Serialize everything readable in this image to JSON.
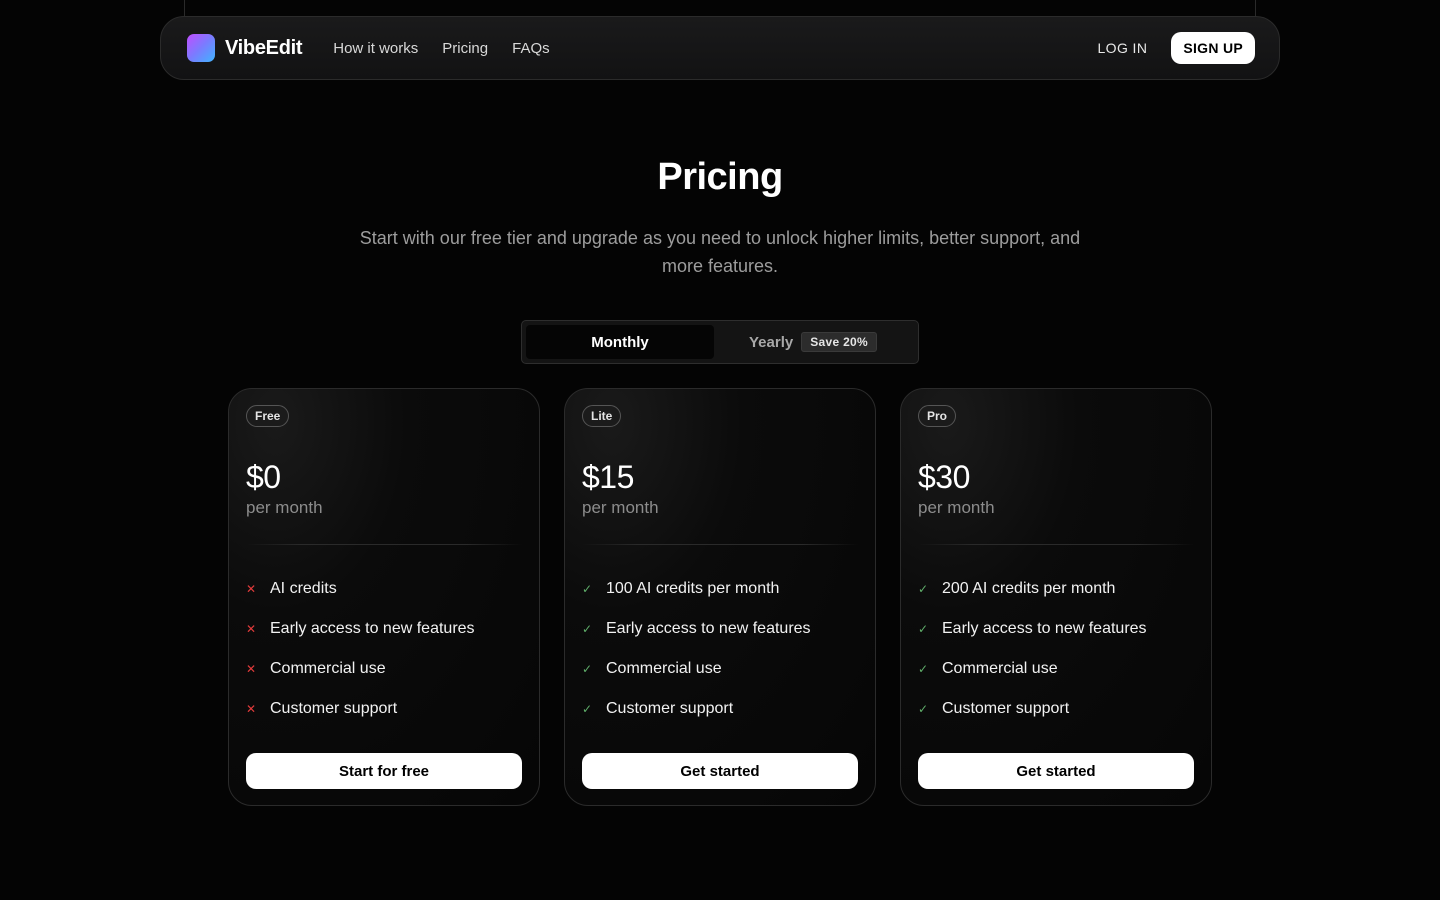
{
  "nav": {
    "brand": "VibeEdit",
    "links": [
      "How it works",
      "Pricing",
      "FAQs"
    ],
    "login": "LOG IN",
    "signup": "SIGN UP"
  },
  "hero": {
    "title": "Pricing",
    "subtitle": "Start with our free tier and upgrade as you need to unlock higher limits, better support, and more features."
  },
  "billing_toggle": {
    "monthly": "Monthly",
    "yearly": "Yearly",
    "save_badge": "Save 20%",
    "selected": "Monthly"
  },
  "plans": [
    {
      "tier": "Free",
      "price": "$0",
      "period": "per month",
      "features": [
        {
          "text": "AI credits",
          "included": false
        },
        {
          "text": "Early access to new features",
          "included": false
        },
        {
          "text": "Commercial use",
          "included": false
        },
        {
          "text": "Customer support",
          "included": false
        }
      ],
      "cta": "Start for free"
    },
    {
      "tier": "Lite",
      "price": "$15",
      "period": "per month",
      "features": [
        {
          "text": "100 AI credits per month",
          "included": true
        },
        {
          "text": "Early access to new features",
          "included": true
        },
        {
          "text": "Commercial use",
          "included": true
        },
        {
          "text": "Customer support",
          "included": true
        }
      ],
      "cta": "Get started"
    },
    {
      "tier": "Pro",
      "price": "$30",
      "period": "per month",
      "features": [
        {
          "text": "200 AI credits per month",
          "included": true
        },
        {
          "text": "Early access to new features",
          "included": true
        },
        {
          "text": "Commercial use",
          "included": true
        },
        {
          "text": "Customer support",
          "included": true
        }
      ],
      "cta": "Get started"
    }
  ],
  "icons": {
    "included": "check-icon",
    "excluded": "x-icon"
  },
  "colors": {
    "background": "#040404",
    "included": "#5fae6a",
    "excluded": "#e23b3b",
    "cta_bg": "#ffffff"
  }
}
